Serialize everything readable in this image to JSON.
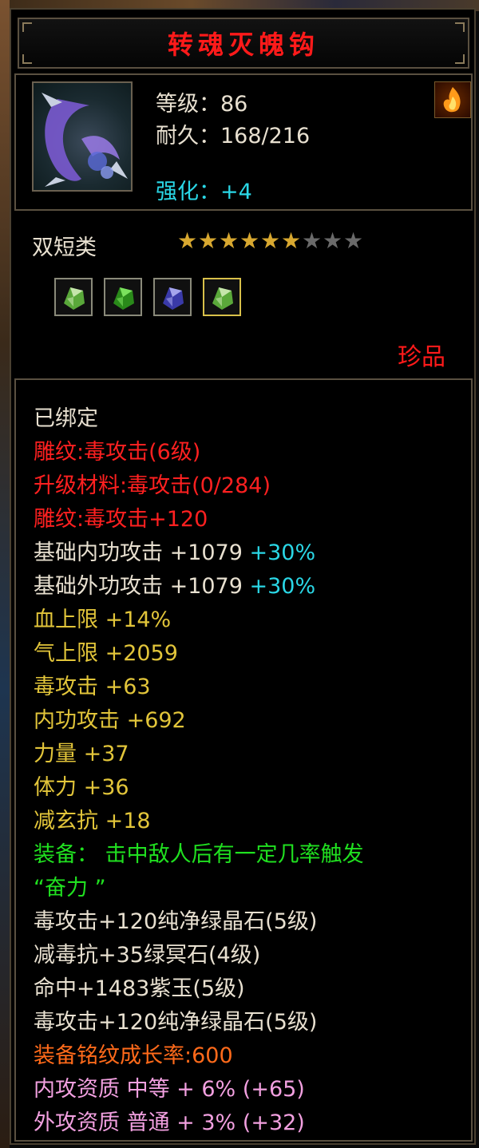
{
  "item": {
    "name": "转魂灭魄钩",
    "level_line": "等级：86",
    "durability_line": "耐久：168/216",
    "strength_line": "强化：+4",
    "category": "双短类",
    "stars": {
      "filled": 6,
      "total": 9
    },
    "rarity": "珍品",
    "gems": [
      "white-green-gem-icon",
      "green-gem-icon",
      "blue-gem-icon",
      "white-green-gem-icon"
    ]
  },
  "attributes": [
    {
      "text": "已绑定",
      "color": "white"
    },
    {
      "text": "雕纹:毒攻击(6级)",
      "color": "red"
    },
    {
      "text": "升级材料:毒攻击(0/284)",
      "color": "red"
    },
    {
      "text": "雕纹:毒攻击+120",
      "color": "red"
    },
    {
      "text": "基础内功攻击 +1079",
      "extra": " +30%",
      "color": "white"
    },
    {
      "text": "基础外功攻击 +1079",
      "extra": " +30%",
      "color": "white"
    },
    {
      "text": "血上限 +14%",
      "color": "yellow"
    },
    {
      "text": "气上限 +2059",
      "color": "yellow"
    },
    {
      "text": "毒攻击 +63",
      "color": "yellow"
    },
    {
      "text": "内功攻击 +692",
      "color": "yellow"
    },
    {
      "text": "力量 +37",
      "color": "yellow"
    },
    {
      "text": "体力 +36",
      "color": "yellow"
    },
    {
      "text": "减玄抗 +18",
      "color": "yellow"
    },
    {
      "text": "装备： 击中敌人后有一定几率触发",
      "color": "green"
    },
    {
      "text": "“奋力 ”",
      "color": "green"
    },
    {
      "text": "毒攻击+120纯净绿晶石(5级)",
      "color": "white"
    },
    {
      "text": "减毒抗+35绿冥石(4级)",
      "color": "white"
    },
    {
      "text": "命中+1483紫玉(5级)",
      "color": "white"
    },
    {
      "text": "毒攻击+120纯净绿晶石(5级)",
      "color": "white"
    },
    {
      "text": "装备铭纹成长率:600",
      "color": "orange"
    },
    {
      "text": "内攻资质 中等 + 6% (+65)",
      "color": "pink"
    },
    {
      "text": "外攻资质 普通 + 3% (+32)",
      "color": "pink"
    }
  ]
}
